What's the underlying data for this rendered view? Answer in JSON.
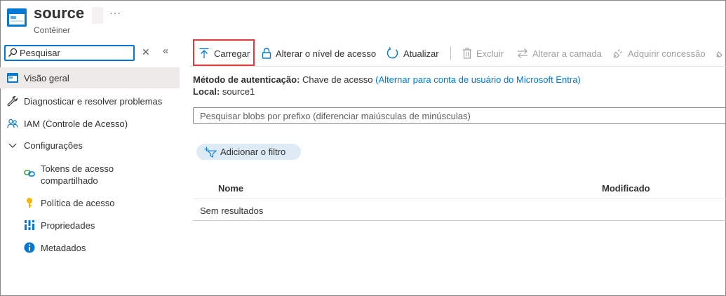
{
  "header": {
    "title": "source",
    "subtitle": "Contêiner",
    "more_icon": "ellipsis-icon"
  },
  "sidebar": {
    "search": {
      "placeholder": "Pesquisar",
      "value": ""
    },
    "items": [
      {
        "label": "Visão geral",
        "icon": "overview-icon",
        "selected": true
      },
      {
        "label": "Diagnosticar e resolver problemas",
        "icon": "wrench-icon"
      },
      {
        "label": "IAM (Controle de Acesso)",
        "icon": "people-icon"
      },
      {
        "label": "Configurações",
        "icon": "chevron-down-icon",
        "expanded": true
      }
    ],
    "sub_items": [
      {
        "label_line1": "Tokens de acesso",
        "label_line2": "compartilhado",
        "icon": "link-icon"
      },
      {
        "label": "Política de acesso",
        "icon": "key-icon"
      },
      {
        "label": "Propriedades",
        "icon": "properties-icon"
      },
      {
        "label": "Metadados",
        "icon": "info-icon"
      }
    ]
  },
  "toolbar": {
    "upload": "Carregar",
    "change_access": "Alterar o nível de acesso",
    "refresh": "Atualizar",
    "delete": "Excluir",
    "change_tier": "Alterar a camada",
    "acquire_lease": "Adquirir concessão"
  },
  "main": {
    "auth_label": "Método de autenticação:",
    "auth_value": "Chave de acesso",
    "auth_link": "(Alternar para conta de usuário do Microsoft Entra)",
    "location_label": "Local:",
    "location_value": "source1",
    "blob_search_placeholder": "Pesquisar blobs por prefixo (diferenciar maiúsculas de minúsculas)",
    "add_filter": "Adicionar o filtro",
    "columns": [
      "Nome",
      "Modificado"
    ],
    "empty_text": "Sem resultados"
  },
  "colors": {
    "accent": "#0078d4",
    "highlight_border": "#e03c3c",
    "selected_bg": "#edebe9",
    "filter_pill_bg": "#ddebf7"
  }
}
